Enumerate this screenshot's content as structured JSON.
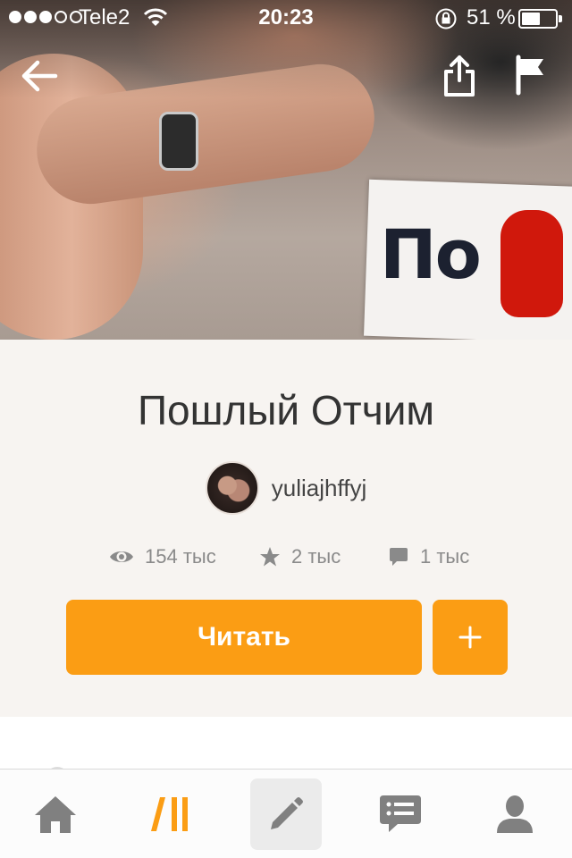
{
  "status_bar": {
    "carrier": "Tele2",
    "time": "20:23",
    "battery_percent": "51 %",
    "signal_bars_filled": 3,
    "signal_bars_total": 5
  },
  "cover": {
    "image_text": "По"
  },
  "story": {
    "title": "Пошлый Отчим",
    "author": "yuliajhffyj"
  },
  "stats": {
    "views": "154 тыс",
    "votes": "2 тыс",
    "comments": "1 тыс"
  },
  "actions": {
    "read_label": "Читать",
    "add_label": "+"
  },
  "tab_bar": {
    "items": [
      "home-icon",
      "library-icon",
      "write-icon",
      "messages-icon",
      "profile-icon"
    ]
  },
  "colors": {
    "accent": "#fb9d14",
    "panel_bg": "#f7f4f1",
    "tab_icon": "#808080"
  }
}
